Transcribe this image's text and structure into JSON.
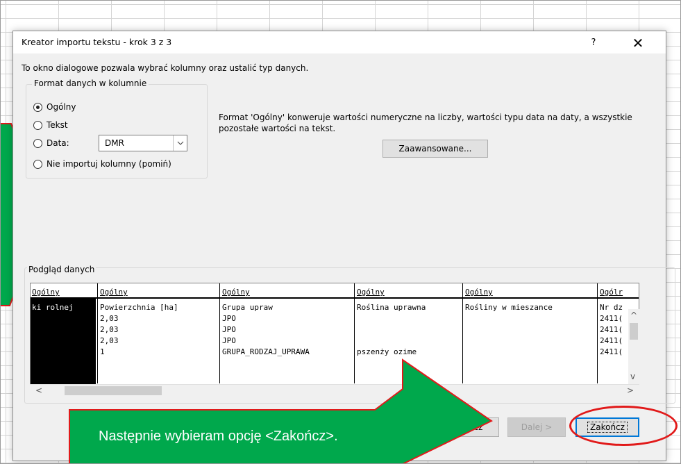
{
  "dialog": {
    "title": "Kreator importu tekstu - krok 3 z 3",
    "help": "?",
    "close": "✕",
    "intro": "To okno dialogowe pozwala wybrać kolumny oraz ustalić typ danych."
  },
  "format_group": {
    "legend": "Format danych w kolumnie",
    "options": [
      {
        "label": "Ogólny",
        "checked": true
      },
      {
        "label": "Tekst",
        "checked": false
      },
      {
        "label": "Data:",
        "checked": false
      },
      {
        "label": "Nie importuj kolumny (pomiń)",
        "checked": false
      }
    ],
    "date_value": "DMR"
  },
  "description": "Format 'Ogólny' konweruje wartości numeryczne na liczby, wartości typu data na daty, a wszystkie pozostałe wartości na tekst.",
  "advanced_label": "Zaawansowane...",
  "preview": {
    "label": "Podgląd danych",
    "headers": [
      "Ogólny",
      "Ogólny",
      "Ogólny",
      "Ogólny",
      "Ogólny",
      "Ogólr"
    ],
    "rows": [
      [
        "ki rolnej",
        "Powierzchnia [ha]",
        "Grupa upraw",
        "Roślina uprawna",
        "Rośliny w mieszance",
        "Nr dz"
      ],
      [
        "",
        "2,03",
        "JPO",
        "",
        "",
        "2411("
      ],
      [
        "",
        "2,03",
        "JPO",
        "",
        "",
        "2411("
      ],
      [
        "",
        "2,03",
        "JPO",
        "",
        "",
        "2411("
      ],
      [
        "",
        "1",
        "GRUPA_RODZAJ_UPRAWA",
        "pszenży   ozime",
        "",
        "2411("
      ]
    ]
  },
  "buttons": {
    "back": "cz",
    "next": "Dalej >",
    "finish": "Zakończ"
  },
  "callout_text": "Następnie wybieram opcję <Zakończ>.",
  "colors": {
    "callout_fill": "#00a84c",
    "annotation_red": "#e11a1a"
  }
}
